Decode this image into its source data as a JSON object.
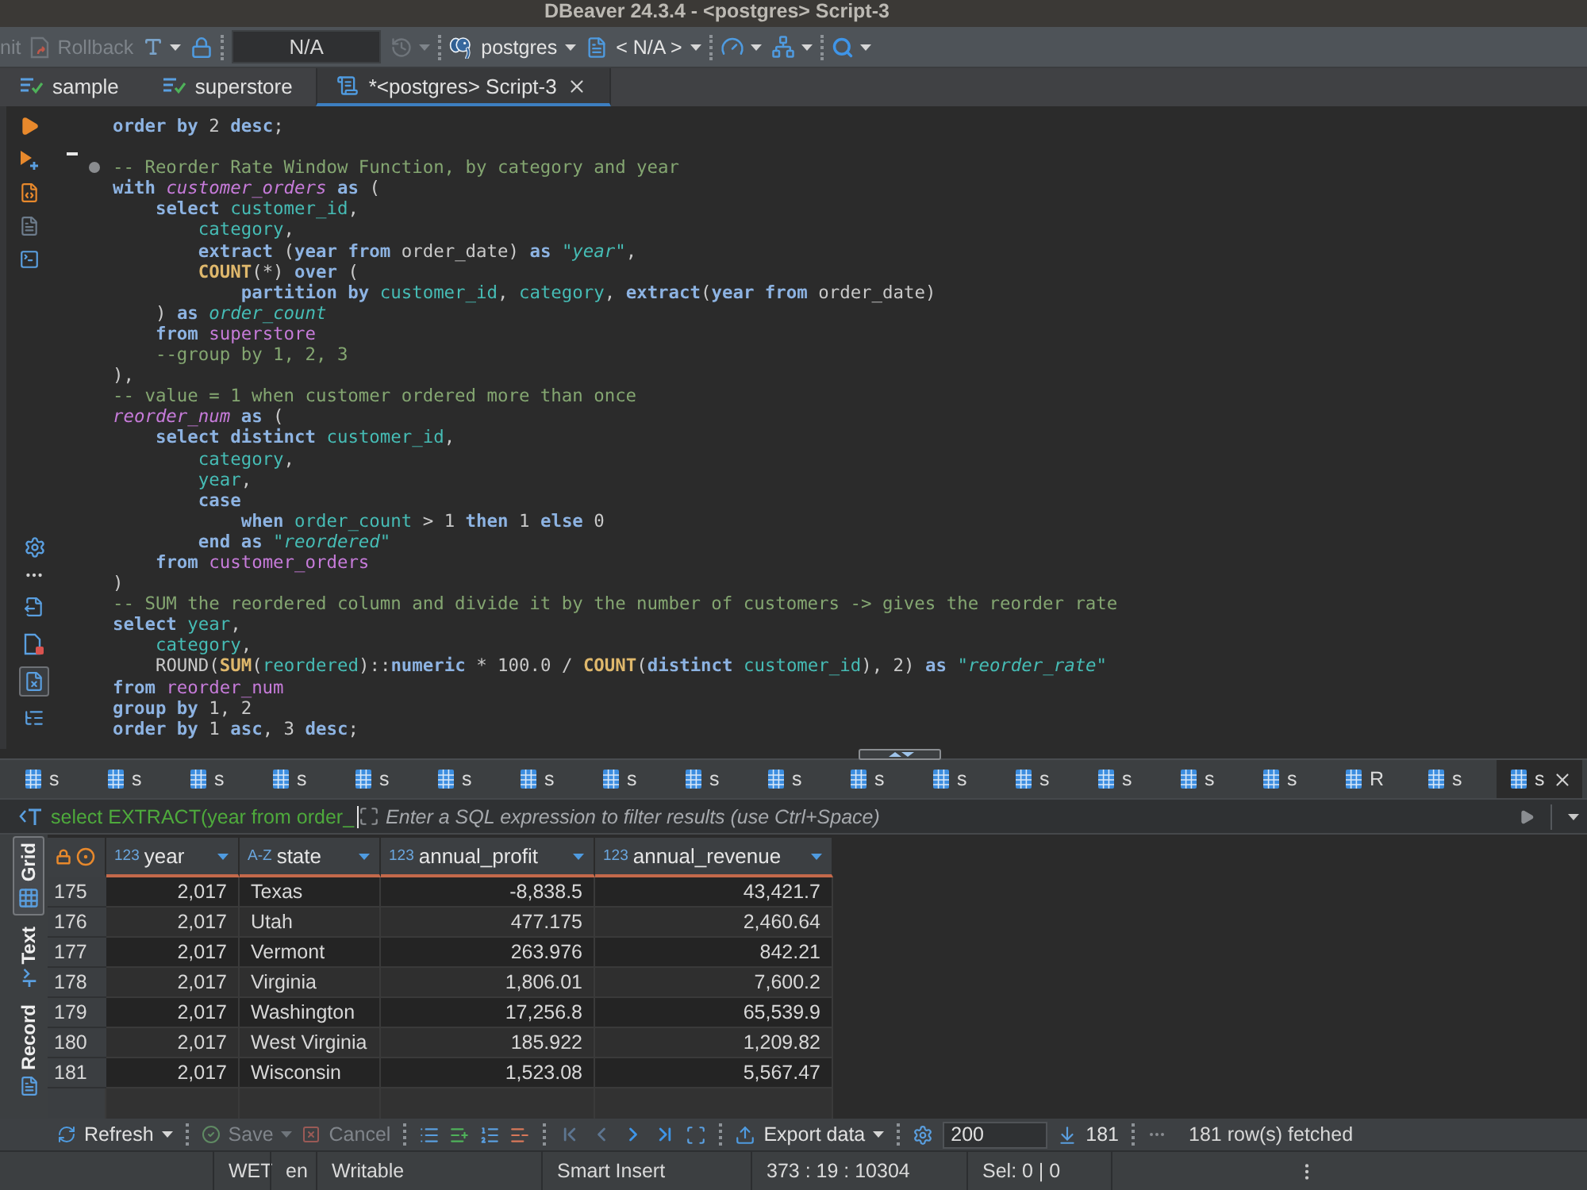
{
  "window": {
    "title": "DBeaver 24.3.4 - <postgres> Script-3"
  },
  "toolbar": {
    "groups": [
      [
        {
          "kind": "commit",
          "label": "nit",
          "disabled": true
        },
        {
          "kind": "rollback",
          "label": "Rollback",
          "disabled": true
        },
        {
          "kind": "transaction_mode",
          "disabled": false
        },
        {
          "kind": "lock",
          "disabled": false
        }
      ],
      [
        {
          "kind": "field",
          "value": "N/A"
        },
        {
          "kind": "history",
          "disabled": true
        }
      ],
      [
        {
          "kind": "datasource",
          "label": "postgres",
          "disabled": false
        },
        {
          "kind": "schema",
          "label": "< N/A >",
          "disabled": false
        }
      ],
      [
        {
          "kind": "dashboard",
          "disabled": false
        },
        {
          "kind": "structure",
          "disabled": false
        }
      ],
      [
        {
          "kind": "search",
          "disabled": false
        }
      ]
    ]
  },
  "editor_tabs": [
    {
      "kind": "editor",
      "label": "sample",
      "selected": false
    },
    {
      "kind": "editor",
      "label": "superstore",
      "selected": false
    },
    {
      "kind": "script",
      "label": "*<postgres> Script-3",
      "selected": true
    }
  ],
  "editor": {
    "panel_toggles": [
      {
        "selected": false
      },
      {
        "selected": false
      },
      {
        "selected": true
      },
      {
        "selected": false
      }
    ],
    "lines": [
      {
        "kind": "code",
        "fold_marker": false,
        "tokens": [
          {
            "kind": "keyword",
            "text": "order by"
          },
          {
            "kind": "plain",
            "text": " 2 "
          },
          {
            "kind": "keyword",
            "text": "desc"
          },
          {
            "kind": "plain",
            "text": ";"
          }
        ]
      },
      {
        "kind": "blank",
        "fold_marker": false
      },
      {
        "kind": "code",
        "fold_marker": true,
        "tokens": [
          {
            "kind": "comment",
            "text": "-- Reorder Rate Window Function, by category and year"
          }
        ]
      },
      {
        "kind": "code",
        "fold_marker": false,
        "tokens": [
          {
            "kind": "keyword",
            "text": "with "
          },
          {
            "kind": "name",
            "text": "customer_orders "
          },
          {
            "kind": "keyword",
            "text": "as"
          },
          {
            "kind": "plain",
            "text": " ("
          }
        ]
      },
      {
        "kind": "code",
        "fold_marker": false,
        "tokens": [
          {
            "kind": "keyword",
            "text": "    select "
          },
          {
            "kind": "column",
            "text": "customer_id"
          },
          {
            "kind": "plain",
            "text": ","
          }
        ]
      },
      {
        "kind": "code",
        "fold_marker": false,
        "tokens": [
          {
            "kind": "column",
            "text": "        category"
          },
          {
            "kind": "plain",
            "text": ","
          }
        ]
      },
      {
        "kind": "code",
        "fold_marker": false,
        "tokens": [
          {
            "kind": "keyword",
            "text": "        extract"
          },
          {
            "kind": "plain",
            "text": " ("
          },
          {
            "kind": "keyword",
            "text": "year from"
          },
          {
            "kind": "plain",
            "text": " order_date) "
          },
          {
            "kind": "keyword",
            "text": "as "
          },
          {
            "kind": "alias",
            "text": "\"year\""
          },
          {
            "kind": "plain",
            "text": ","
          }
        ]
      },
      {
        "kind": "code",
        "fold_marker": false,
        "tokens": [
          {
            "kind": "function",
            "text": "        COUNT"
          },
          {
            "kind": "plain",
            "text": "(*) "
          },
          {
            "kind": "keyword",
            "text": "over"
          },
          {
            "kind": "plain",
            "text": " ("
          }
        ]
      },
      {
        "kind": "code",
        "fold_marker": false,
        "tokens": [
          {
            "kind": "keyword",
            "text": "            partition by "
          },
          {
            "kind": "column",
            "text": "customer_id"
          },
          {
            "kind": "plain",
            "text": ", "
          },
          {
            "kind": "column",
            "text": "category"
          },
          {
            "kind": "plain",
            "text": ", "
          },
          {
            "kind": "keyword",
            "text": "extract"
          },
          {
            "kind": "plain",
            "text": "("
          },
          {
            "kind": "keyword",
            "text": "year from"
          },
          {
            "kind": "plain",
            "text": " order_date)"
          }
        ]
      },
      {
        "kind": "code",
        "fold_marker": false,
        "tokens": [
          {
            "kind": "plain",
            "text": "    ) "
          },
          {
            "kind": "keyword",
            "text": "as "
          },
          {
            "kind": "alias",
            "text": "order_count"
          }
        ]
      },
      {
        "kind": "code",
        "fold_marker": false,
        "tokens": [
          {
            "kind": "keyword",
            "text": "    from "
          },
          {
            "kind": "table",
            "text": "superstore"
          }
        ]
      },
      {
        "kind": "code",
        "fold_marker": false,
        "tokens": [
          {
            "kind": "comment",
            "text": "    --group by 1, 2, 3"
          }
        ]
      },
      {
        "kind": "code",
        "fold_marker": false,
        "tokens": [
          {
            "kind": "plain",
            "text": "),"
          }
        ]
      },
      {
        "kind": "code",
        "fold_marker": false,
        "tokens": [
          {
            "kind": "comment",
            "text": "-- value = 1 when customer ordered more than once"
          }
        ]
      },
      {
        "kind": "code",
        "fold_marker": false,
        "tokens": [
          {
            "kind": "name",
            "text": "reorder_num "
          },
          {
            "kind": "keyword",
            "text": "as"
          },
          {
            "kind": "plain",
            "text": " ("
          }
        ]
      },
      {
        "kind": "code",
        "fold_marker": false,
        "tokens": [
          {
            "kind": "keyword",
            "text": "    select distinct "
          },
          {
            "kind": "column",
            "text": "customer_id"
          },
          {
            "kind": "plain",
            "text": ","
          }
        ]
      },
      {
        "kind": "code",
        "fold_marker": false,
        "tokens": [
          {
            "kind": "column",
            "text": "        category"
          },
          {
            "kind": "plain",
            "text": ","
          }
        ]
      },
      {
        "kind": "code",
        "fold_marker": false,
        "tokens": [
          {
            "kind": "column",
            "text": "        year"
          },
          {
            "kind": "plain",
            "text": ","
          }
        ]
      },
      {
        "kind": "code",
        "fold_marker": false,
        "tokens": [
          {
            "kind": "keyword",
            "text": "        case"
          }
        ]
      },
      {
        "kind": "code",
        "fold_marker": false,
        "tokens": [
          {
            "kind": "keyword",
            "text": "            when "
          },
          {
            "kind": "column",
            "text": "order_count"
          },
          {
            "kind": "plain",
            "text": " > 1 "
          },
          {
            "kind": "keyword",
            "text": "then"
          },
          {
            "kind": "plain",
            "text": " 1 "
          },
          {
            "kind": "keyword",
            "text": "else"
          },
          {
            "kind": "plain",
            "text": " 0"
          }
        ]
      },
      {
        "kind": "code",
        "fold_marker": false,
        "tokens": [
          {
            "kind": "keyword",
            "text": "        end as "
          },
          {
            "kind": "alias",
            "text": "\"reordered\""
          }
        ]
      },
      {
        "kind": "code",
        "fold_marker": false,
        "tokens": [
          {
            "kind": "keyword",
            "text": "    from "
          },
          {
            "kind": "table",
            "text": "customer_orders"
          }
        ]
      },
      {
        "kind": "code",
        "fold_marker": false,
        "tokens": [
          {
            "kind": "plain",
            "text": ")"
          }
        ]
      },
      {
        "kind": "code",
        "fold_marker": false,
        "tokens": [
          {
            "kind": "comment",
            "text": "-- SUM the reordered column and divide it by the number of customers -> gives the reorder rate"
          }
        ]
      },
      {
        "kind": "code",
        "fold_marker": false,
        "tokens": [
          {
            "kind": "keyword",
            "text": "select "
          },
          {
            "kind": "column",
            "text": "year"
          },
          {
            "kind": "plain",
            "text": ","
          }
        ]
      },
      {
        "kind": "code",
        "fold_marker": false,
        "tokens": [
          {
            "kind": "column",
            "text": "    category"
          },
          {
            "kind": "plain",
            "text": ","
          }
        ]
      },
      {
        "kind": "code",
        "fold_marker": false,
        "tokens": [
          {
            "kind": "plain",
            "text": "    ROUND("
          },
          {
            "kind": "function",
            "text": "SUM"
          },
          {
            "kind": "plain",
            "text": "("
          },
          {
            "kind": "column",
            "text": "reordered"
          },
          {
            "kind": "plain",
            "text": ")::"
          },
          {
            "kind": "keyword",
            "text": "numeric"
          },
          {
            "kind": "plain",
            "text": " * 100.0 / "
          },
          {
            "kind": "function",
            "text": "COUNT"
          },
          {
            "kind": "plain",
            "text": "("
          },
          {
            "kind": "keyword",
            "text": "distinct "
          },
          {
            "kind": "column",
            "text": "customer_id"
          },
          {
            "kind": "plain",
            "text": "), 2) "
          },
          {
            "kind": "keyword",
            "text": "as "
          },
          {
            "kind": "alias",
            "text": "\"reorder_rate\""
          }
        ]
      },
      {
        "kind": "code",
        "fold_marker": false,
        "tokens": [
          {
            "kind": "keyword",
            "text": "from "
          },
          {
            "kind": "table",
            "text": "reorder_num"
          }
        ]
      },
      {
        "kind": "code",
        "fold_marker": false,
        "tokens": [
          {
            "kind": "keyword",
            "text": "group by"
          },
          {
            "kind": "plain",
            "text": " 1, 2"
          }
        ]
      },
      {
        "kind": "code",
        "fold_marker": false,
        "tokens": [
          {
            "kind": "keyword",
            "text": "order by"
          },
          {
            "kind": "plain",
            "text": " 1 "
          },
          {
            "kind": "keyword",
            "text": "asc"
          },
          {
            "kind": "plain",
            "text": ", 3 "
          },
          {
            "kind": "keyword",
            "text": "desc"
          },
          {
            "kind": "plain",
            "text": ";"
          }
        ]
      }
    ]
  },
  "result_tabs": [
    {
      "label": "s",
      "selected": false
    },
    {
      "label": "s",
      "selected": false
    },
    {
      "label": "s",
      "selected": false
    },
    {
      "label": "s",
      "selected": false
    },
    {
      "label": "s",
      "selected": false
    },
    {
      "label": "s",
      "selected": false
    },
    {
      "label": "s",
      "selected": false
    },
    {
      "label": "s",
      "selected": false
    },
    {
      "label": "s",
      "selected": false
    },
    {
      "label": "s",
      "selected": false
    },
    {
      "label": "s",
      "selected": false
    },
    {
      "label": "s",
      "selected": false
    },
    {
      "label": "s",
      "selected": false
    },
    {
      "label": "s",
      "selected": false
    },
    {
      "label": "s",
      "selected": false
    },
    {
      "label": "s",
      "selected": false
    },
    {
      "label": "R",
      "selected": false
    },
    {
      "label": "s",
      "selected": false
    },
    {
      "label": "s",
      "selected": true
    }
  ],
  "filter": {
    "query": "select EXTRACT(year from order_",
    "placeholder": "Enter a SQL expression to filter results (use Ctrl+Space)"
  },
  "view_tabs": [
    {
      "kind": "grid",
      "label": "Grid",
      "selected": true
    },
    {
      "kind": "text",
      "label": "Text",
      "selected": false
    },
    {
      "kind": "record",
      "label": "Record",
      "selected": false
    }
  ],
  "grid": {
    "columns": [
      {
        "kind": "number",
        "type_label": "123",
        "name": "year"
      },
      {
        "kind": "text",
        "type_label": "A-Z",
        "name": "state"
      },
      {
        "kind": "number",
        "type_label": "123",
        "name": "annual_profit"
      },
      {
        "kind": "number",
        "type_label": "123",
        "name": "annual_revenue"
      }
    ],
    "rows": [
      {
        "number": "175",
        "cells": [
          "2,017",
          "Texas",
          "-8,838.5",
          "43,421.7"
        ]
      },
      {
        "number": "176",
        "cells": [
          "2,017",
          "Utah",
          "477.175",
          "2,460.64"
        ]
      },
      {
        "number": "177",
        "cells": [
          "2,017",
          "Vermont",
          "263.976",
          "842.21"
        ]
      },
      {
        "number": "178",
        "cells": [
          "2,017",
          "Virginia",
          "1,806.01",
          "7,600.2"
        ]
      },
      {
        "number": "179",
        "cells": [
          "2,017",
          "Washington",
          "17,256.8",
          "65,539.9"
        ]
      },
      {
        "number": "180",
        "cells": [
          "2,017",
          "West Virginia",
          "185.922",
          "1,209.82"
        ]
      },
      {
        "number": "181",
        "cells": [
          "2,017",
          "Wisconsin",
          "1,523.08",
          "5,567.47"
        ]
      }
    ]
  },
  "results_toolbar": {
    "refresh": {
      "label": "Refresh",
      "disabled": false
    },
    "save": {
      "label": "Save",
      "disabled": true
    },
    "cancel": {
      "label": "Cancel",
      "disabled": true
    },
    "navigation": [
      {
        "disabled": true
      },
      {
        "disabled": true
      },
      {
        "disabled": false
      },
      {
        "disabled": false
      }
    ],
    "export": {
      "label": "Export data",
      "disabled": false
    },
    "fetch_size": {
      "value": "200"
    },
    "fetch_all": {
      "label": "181"
    },
    "message": "181 row(s) fetched"
  },
  "status_bar": {
    "cells": [
      "WET",
      "en",
      "Writable",
      "Smart Insert",
      "373 : 19 : 10304",
      "Sel: 0 | 0"
    ]
  }
}
